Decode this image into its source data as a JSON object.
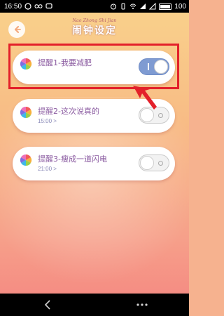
{
  "status_bar": {
    "time": "16:50",
    "battery": "100"
  },
  "header": {
    "title_en": "Nao Zhong Shi Jian",
    "title_cn": "闹钟设定"
  },
  "reminders": [
    {
      "title": "提醒1-我要减肥",
      "time": "",
      "enabled": true
    },
    {
      "title": "提醒2-这次说真的",
      "time": "15:00 >",
      "enabled": false
    },
    {
      "title": "提醒3-瘦成一道闪电",
      "time": "21:00 >",
      "enabled": false
    }
  ],
  "colors": {
    "accent": "#7f9bd2",
    "highlight": "#e3202a",
    "title_text": "#8a5aa0"
  },
  "icons": {
    "back": "back-arrow-icon",
    "reminder": "color-wheel-icon",
    "nav_back": "chevron-left-icon",
    "nav_menu": "more-dots-icon"
  }
}
